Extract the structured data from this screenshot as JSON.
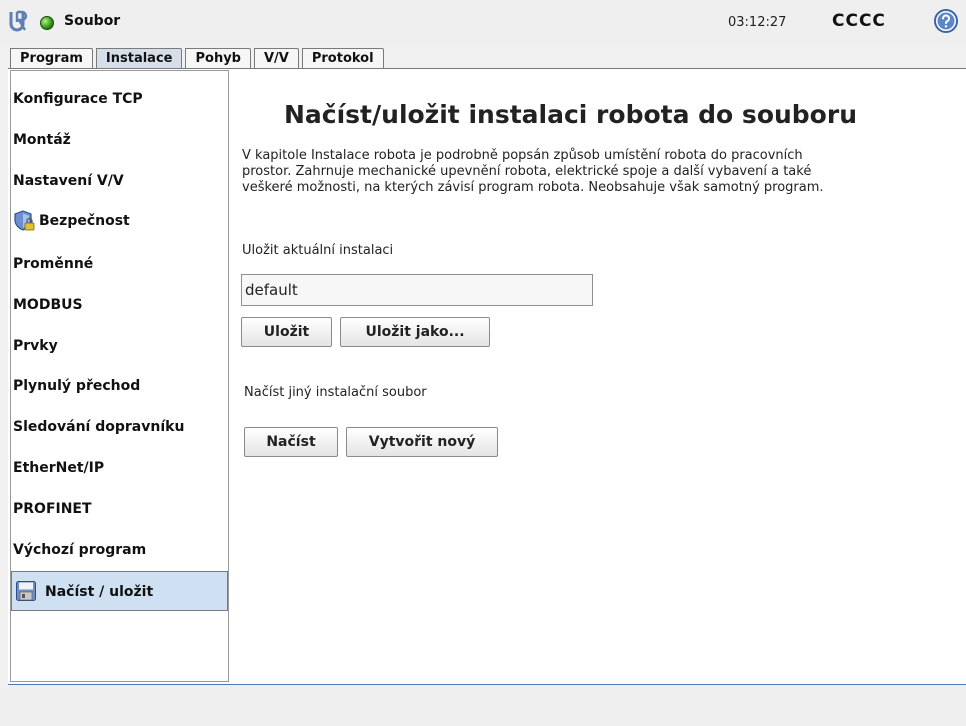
{
  "header": {
    "app_title": "Soubor",
    "time": "03:12:27",
    "user": "CCCC",
    "status_color": "#3a9c1c"
  },
  "tabs": [
    {
      "label": "Program"
    },
    {
      "label": "Instalace",
      "active": true
    },
    {
      "label": "Pohyb"
    },
    {
      "label": "V/V"
    },
    {
      "label": "Protokol"
    }
  ],
  "sidebar": {
    "items": [
      {
        "label": "Konfigurace TCP"
      },
      {
        "label": "Montáž"
      },
      {
        "label": "Nastavení V/V"
      },
      {
        "label": "Bezpečnost",
        "icon": "shield-lock-icon"
      },
      {
        "label": "Proměnné"
      },
      {
        "label": "MODBUS"
      },
      {
        "label": "Prvky"
      },
      {
        "label": "Plynulý přechod"
      },
      {
        "label": "Sledování dopravníku"
      },
      {
        "label": "EtherNet/IP"
      },
      {
        "label": "PROFINET"
      },
      {
        "label": "Výchozí program"
      },
      {
        "label": "Načíst / uložit",
        "icon": "floppy-disk-icon",
        "active": true
      }
    ]
  },
  "main": {
    "title": "Načíst/uložit instalaci robota do souboru",
    "description_line1": "V kapitole Instalace robota je podrobně popsán způsob umístění robota do pracovních",
    "description_line2": "prostor. Zahrnuje mechanické upevnění robota, elektrické spoje a další vybavení a také",
    "description_line3": "veškeré možnosti, na kterých závisí program robota. Neobsahuje však samotný program.",
    "save_section_label": "Uložit aktuální instalaci",
    "installation_name": "default",
    "save_button": "Uložit",
    "save_as_button": "Uložit jako...",
    "load_section_label": "Načíst jiný instalační soubor",
    "load_button": "Načíst",
    "create_new_button": "Vytvořit nový"
  }
}
